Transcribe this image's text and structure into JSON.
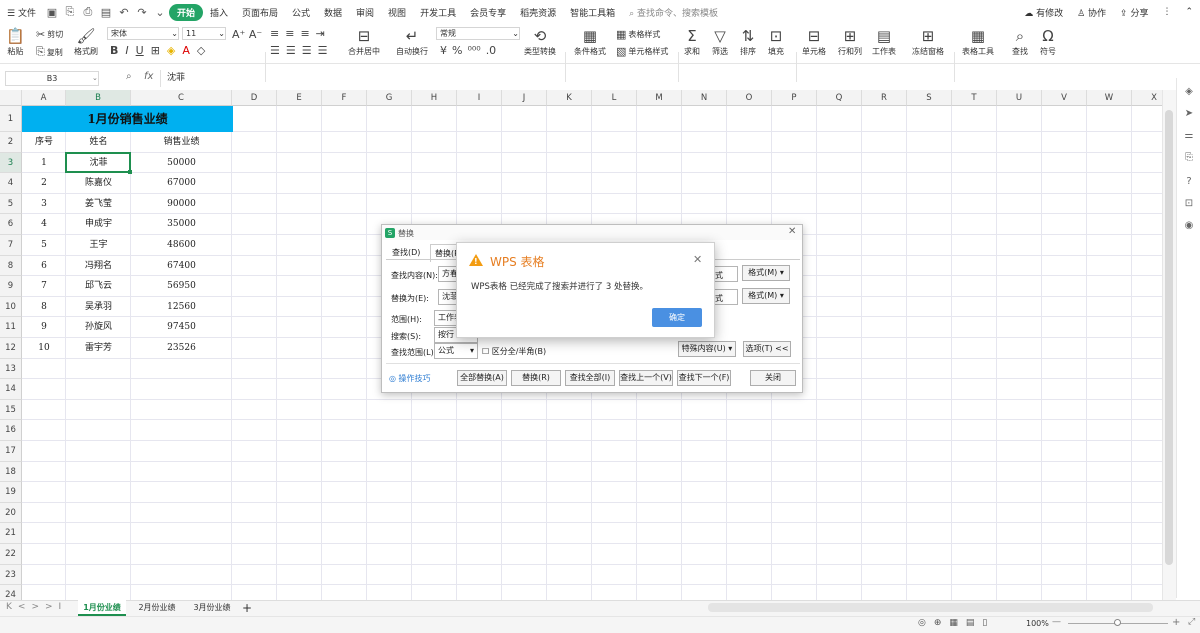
{
  "menubar": {
    "file": "文件",
    "items": [
      "开始",
      "插入",
      "页面布局",
      "公式",
      "数据",
      "审阅",
      "视图",
      "开发工具",
      "会员专享",
      "稻壳资源",
      "智能工具箱"
    ],
    "search_placeholder": "查找命令、搜索模板",
    "right": [
      "有修改",
      "协作",
      "分享"
    ]
  },
  "ribbon": {
    "paste": "粘贴",
    "cut": "剪切",
    "copy": "复制",
    "format_painter": "格式刷",
    "font_name": "宋体",
    "font_size": "11",
    "merge": "合并居中",
    "wrap": "自动换行",
    "number_format": "常规",
    "convert": "类型转换",
    "cond_format": "条件格式",
    "table_style": "表格样式",
    "cell_style": "单元格样式",
    "sum": "求和",
    "filter": "筛选",
    "sort": "排序",
    "fill": "填充",
    "cell": "单元格",
    "rowcol": "行和列",
    "worksheet": "工作表",
    "freeze": "冻结窗格",
    "table_tools": "表格工具",
    "find": "查找",
    "symbol": "符号"
  },
  "formula_bar": {
    "cell_ref": "B3",
    "fx": "fx",
    "value": "沈菲"
  },
  "columns": [
    "A",
    "B",
    "C",
    "D",
    "E",
    "F",
    "G",
    "H",
    "I",
    "J",
    "K",
    "L",
    "M",
    "N",
    "O",
    "P",
    "Q",
    "R",
    "S",
    "T",
    "U",
    "V",
    "W",
    "X"
  ],
  "rows": [
    "1",
    "2",
    "3",
    "4",
    "5",
    "6",
    "7",
    "8",
    "9",
    "10",
    "11",
    "12",
    "13",
    "14",
    "15",
    "16",
    "17",
    "18",
    "19",
    "20",
    "21",
    "22",
    "23",
    "24"
  ],
  "sheet": {
    "title": "1月份销售业绩",
    "headers": [
      "序号",
      "姓名",
      "销售业绩"
    ],
    "data": [
      [
        "1",
        "沈菲",
        "50000"
      ],
      [
        "2",
        "陈嘉仪",
        "67000"
      ],
      [
        "3",
        "姜飞莹",
        "90000"
      ],
      [
        "4",
        "申成宇",
        "35000"
      ],
      [
        "5",
        "王宇",
        "48600"
      ],
      [
        "6",
        "冯翔名",
        "67400"
      ],
      [
        "7",
        "邱飞云",
        "56950"
      ],
      [
        "8",
        "吴承羽",
        "12560"
      ],
      [
        "9",
        "孙旋风",
        "97450"
      ],
      [
        "10",
        "雷宇芳",
        "23526"
      ]
    ]
  },
  "tabs": [
    "1月份业绩",
    "2月份业绩",
    "3月份业绩"
  ],
  "status": {
    "zoom": "100%"
  },
  "replace_dialog": {
    "title": "替换",
    "tab_find": "查找(D)",
    "tab_replace": "替换(P)",
    "find_label": "查找内容(N):",
    "find_value": "方春",
    "replace_label": "替换为(E):",
    "replace_value": "沈菲",
    "format_btn_1": "格式(M)",
    "format_btn_2": "格式(M)",
    "format_text_1": "式",
    "format_text_2": "式",
    "scope_label": "范围(H):",
    "scope_value": "工作表",
    "search_label": "搜索(S):",
    "search_value": "按行",
    "lookin_label": "查找范围(L):",
    "lookin_value": "公式",
    "fullwidth": "区分全/半角(B)",
    "special": "特殊内容(U)",
    "options": "选项(T) <<",
    "tips": "操作技巧",
    "btn_replace_all": "全部替换(A)",
    "btn_replace": "替换(R)",
    "btn_find_all": "查找全部(I)",
    "btn_find_prev": "查找上一个(V)",
    "btn_find_next": "查找下一个(F)",
    "btn_close": "关闭"
  },
  "alert": {
    "title": "WPS 表格",
    "message": "WPS表格 已经完成了搜索并进行了 3 处替换。",
    "ok": "确定"
  }
}
